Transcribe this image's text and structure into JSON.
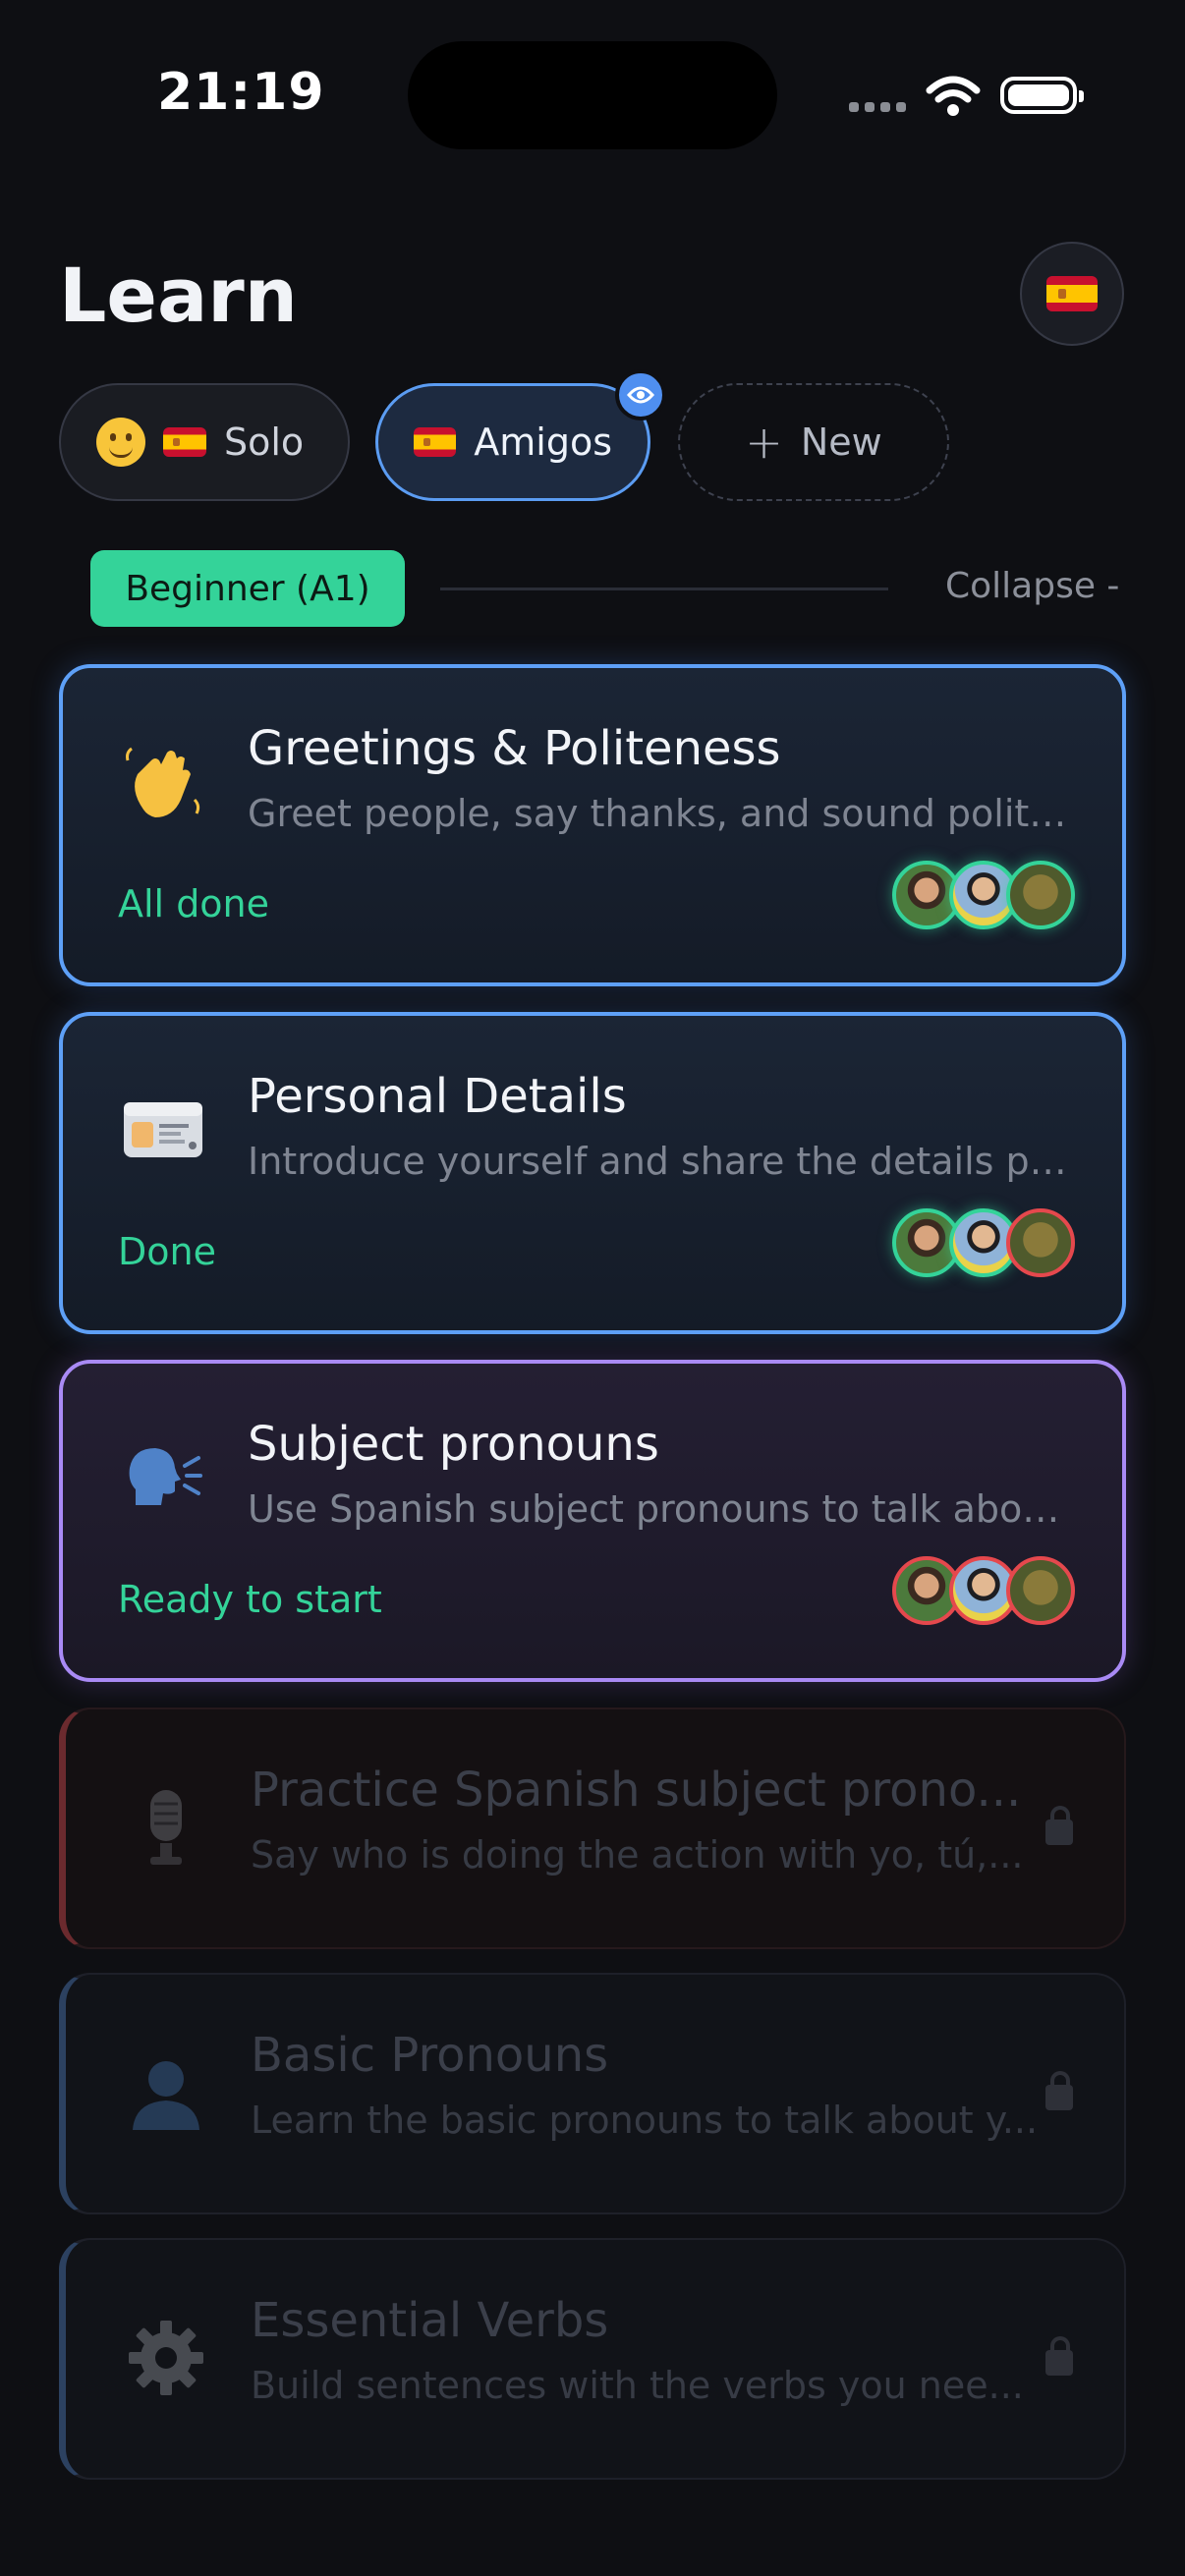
{
  "status_bar": {
    "time": "21:19"
  },
  "header": {
    "title": "Learn",
    "language_flag_icon": "spain-flag-icon"
  },
  "groups": {
    "solo": {
      "label": "Solo",
      "emoji": "slightly-smiling-face-icon"
    },
    "amigos": {
      "label": "Amigos",
      "selected": true
    },
    "new": {
      "label": "New"
    }
  },
  "level": {
    "label": "Beginner (A1)",
    "collapse_label": "Collapse -"
  },
  "colors": {
    "accent_blue": "#5ea0f7",
    "accent_green": "#34d399",
    "accent_purple": "#a98af5",
    "error_red": "#e5484d"
  },
  "lessons": [
    {
      "icon": "waving-hand-icon",
      "title": "Greetings & Politeness",
      "description": "Greet people, say thanks, and sound polite fr...",
      "status": "All done",
      "locked": false
    },
    {
      "icon": "id-card-icon",
      "title": "Personal Details",
      "description": "Introduce yourself and share the details peop...",
      "status": "Done",
      "locked": false
    },
    {
      "icon": "speaking-head-icon",
      "title": "Subject pronouns",
      "description": "Use Spanish subject pronouns to talk about y...",
      "status": "Ready to start",
      "locked": false
    },
    {
      "icon": "microphone-icon",
      "title": "Practice Spanish subject prono...",
      "description": "Say who is doing the action with yo, tú,...",
      "locked": true
    },
    {
      "icon": "bust-silhouette-icon",
      "title": "Basic Pronouns",
      "description": "Learn the basic pronouns to talk about y...",
      "locked": true
    },
    {
      "icon": "gear-icon",
      "title": "Essential Verbs",
      "description": "Build sentences with the verbs you nee...",
      "locked": true
    }
  ]
}
